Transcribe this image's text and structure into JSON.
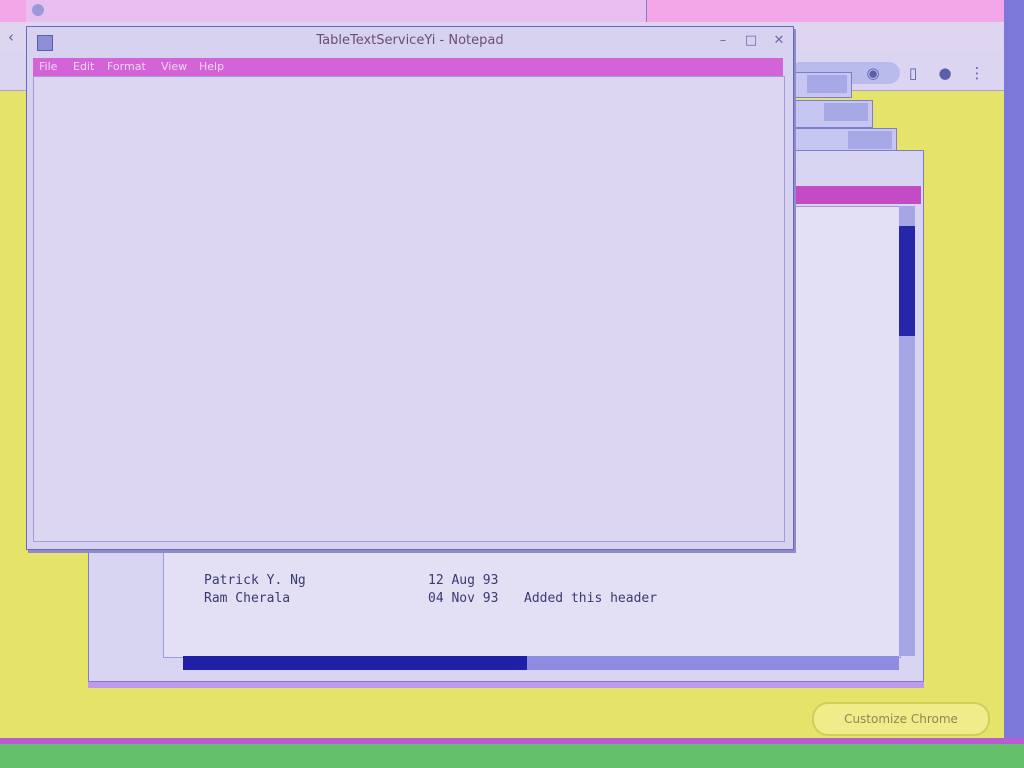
{
  "browser": {
    "tab_title": "",
    "toolbar_icons": [
      "back-icon",
      "extension-icon",
      "sidebar-icon",
      "profile-icon",
      "menu-icon"
    ],
    "customize_button_label": "Customize Chrome"
  },
  "back_window": {
    "lines": [
      {
        "name": "Patrick Y. Ng",
        "date": "12 Aug 93",
        "note": ""
      },
      {
        "name": "Ram Cherala",
        "date": "04 Nov 93",
        "note": "Added this header"
      }
    ]
  },
  "notepad": {
    "title": "TableTextServiceYi - Notepad",
    "menu": [
      "File",
      "Edit",
      "Format",
      "View",
      "Help"
    ],
    "content": ""
  },
  "colors": {
    "desktop": "#e8e34a",
    "menubar": "#d463d8",
    "scroll_thumb": "#1f1fa8",
    "taskbar": "#64c06a"
  }
}
